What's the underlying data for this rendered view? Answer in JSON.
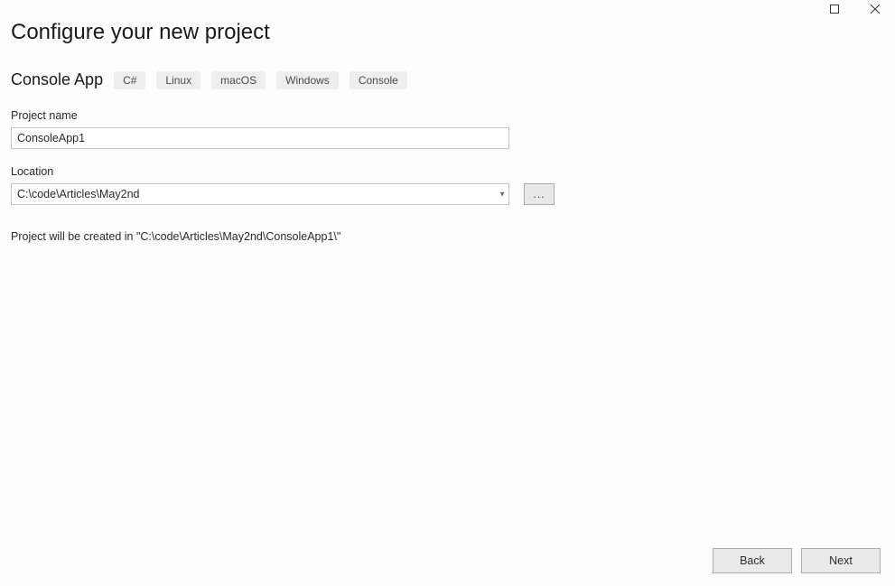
{
  "window": {
    "maximize_title": "Maximize",
    "close_title": "Close"
  },
  "header": {
    "title": "Configure your new project",
    "subtitle": "Console App",
    "tags": [
      "C#",
      "Linux",
      "macOS",
      "Windows",
      "Console"
    ]
  },
  "fields": {
    "project_name_label": "Project name",
    "project_name_value": "ConsoleApp1",
    "location_label": "Location",
    "location_value": "C:\\code\\Articles\\May2nd",
    "browse_label": "..."
  },
  "info_text": "Project will be created in \"C:\\code\\Articles\\May2nd\\ConsoleApp1\\\"",
  "footer": {
    "back_label": "Back",
    "next_label": "Next"
  }
}
